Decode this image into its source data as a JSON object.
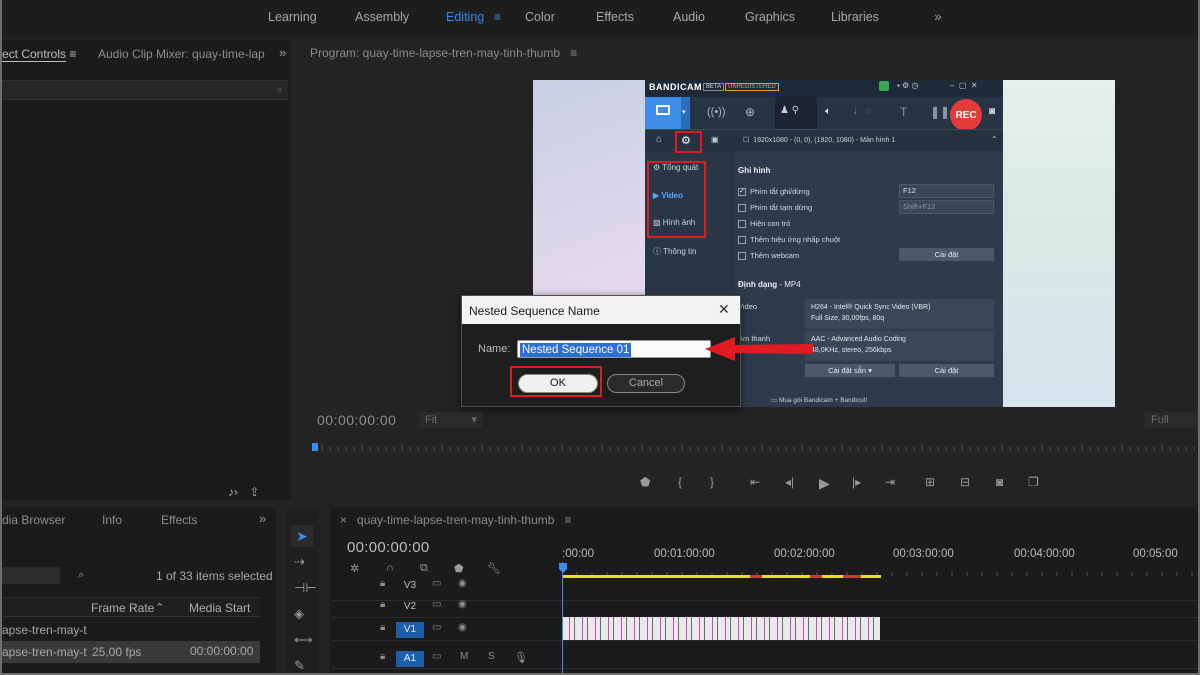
{
  "workspace": {
    "tabs": [
      "Learning",
      "Assembly",
      "Editing",
      "Color",
      "Effects",
      "Audio",
      "Graphics",
      "Libraries"
    ],
    "active": "Editing",
    "more": "»"
  },
  "left_panel": {
    "tab1": "ect Controls",
    "tab1_menu": "≡",
    "tab2": "Audio Clip Mixer: quay-time-lap",
    "more": "»"
  },
  "program": {
    "title": "Program: quay-time-lapse-tren-may-tinh-thumb",
    "title_menu": "≡",
    "timecode": "00:00:00:00",
    "fit": "Fit",
    "full": "Full"
  },
  "bandicam": {
    "logo": "BANDICAM",
    "badge_beta": "BETA",
    "badge_unreg": "UNREGISTERED",
    "rec": "REC",
    "resolution_text": "1920x1080 - (0, 0), (1920, 1080) - Màn hình 1",
    "sidebar": [
      {
        "label": "Tổng quát",
        "icon": "gear-icon"
      },
      {
        "label": "Video",
        "icon": "video-icon"
      },
      {
        "label": "Hình ảnh",
        "icon": "image-icon"
      },
      {
        "label": "Thông tin",
        "icon": "info-icon"
      }
    ],
    "section_record": "Ghi hình",
    "checkboxes": [
      {
        "label": "Phím tắt ghi/dừng",
        "checked": true
      },
      {
        "label": "Phím tắt tạm dừng",
        "checked": false
      },
      {
        "label": "Hiện con trỏ",
        "checked": false
      },
      {
        "label": "Thêm hiệu ứng nhấp chuột",
        "checked": false
      },
      {
        "label": "Thêm webcam",
        "checked": false
      }
    ],
    "hotkey_record": "F12",
    "hotkey_pause": "Shift+F12",
    "settings_btn": "Cài đặt",
    "format_label": "Định dạng",
    "format_value": "- MP4",
    "video_label": "Video",
    "audio_label": "Âm thanh",
    "video_info_1": "H264 - Intel® Quick Sync Video (VBR)",
    "video_info_2": "Full Size, 30,00fps, 80q",
    "audio_info_1": "AAC - Advanced Audio Coding",
    "audio_info_2": "48,0KHz, stereo, 256kbps",
    "preset_btn": "Cài đặt sẵn",
    "settings_btn2": "Cài đặt",
    "promo": "Mua gói Bandicam + Bandicut!"
  },
  "dialog": {
    "title": "Nested Sequence Name",
    "close": "✕",
    "name_label": "Name:",
    "name_value": "Nested Sequence 01",
    "ok": "OK",
    "cancel": "Cancel"
  },
  "project": {
    "tab1": "dia Browser",
    "tab2": "Info",
    "tab3": "Effects",
    "more": "»",
    "count": "1 of 33 items selected",
    "col_frame_rate": "Frame Rate",
    "col_media_start": "Media Start",
    "rows": [
      {
        "name": "apse-tren-may-t",
        "fps": "",
        "start": ""
      },
      {
        "name": "apse-tren-may-t",
        "fps": "25,00 fps",
        "start": "00:00:00:00"
      }
    ]
  },
  "timeline": {
    "tab_close": "×",
    "tab": "quay-time-lapse-tren-may-tinh-thumb",
    "tab_menu": "≡",
    "timecode": "00:00:00:00",
    "ruler": [
      ":00:00",
      "00:01:00:00",
      "00:02:00:00",
      "00:03:00:00",
      "00:04:00:00",
      "00:05:00"
    ],
    "tracks": [
      "V3",
      "V2",
      "V1",
      "A1"
    ],
    "a1_m": "M",
    "a1_s": "S"
  },
  "colors": {
    "accent": "#2d8ceb",
    "highlight_red": "#e01b22",
    "bandicam_bg": "#2f3b4c",
    "rec_red": "#e43a3a",
    "work_area_yellow": "#e7e21b"
  }
}
